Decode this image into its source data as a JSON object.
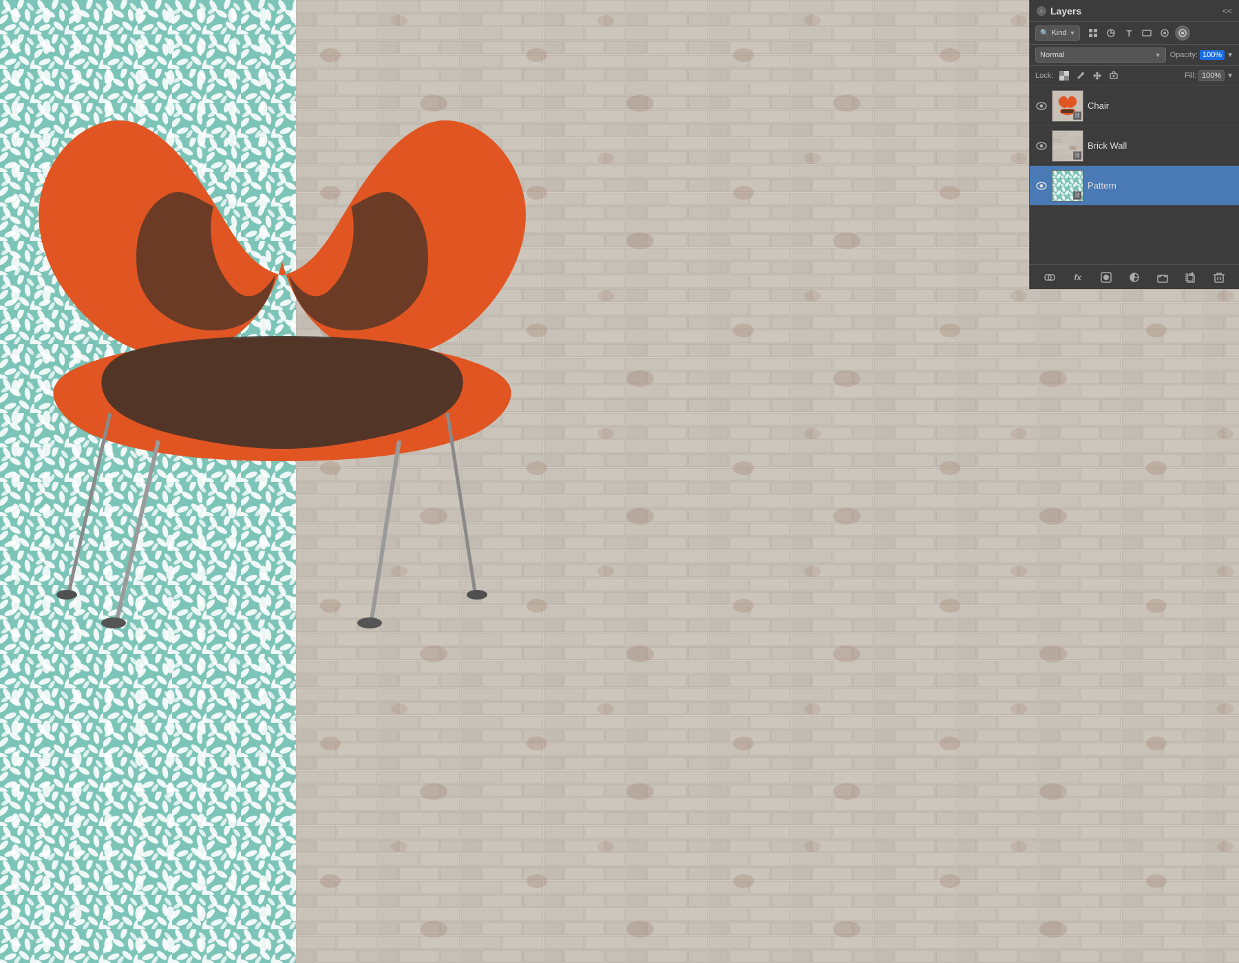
{
  "panel": {
    "title": "Layers",
    "close_label": "×",
    "expand_label": "<<"
  },
  "filter": {
    "kind_label": "Kind",
    "kind_placeholder": "Kind"
  },
  "blend": {
    "mode": "Normal",
    "opacity_label": "Opacity:",
    "opacity_value": "100%",
    "fill_label": "Fill:",
    "fill_value": "100%"
  },
  "lock": {
    "label": "Lock:"
  },
  "layers": [
    {
      "name": "Chair",
      "visible": true,
      "active": false,
      "thumb_type": "chair"
    },
    {
      "name": "Brick Wall",
      "visible": true,
      "active": false,
      "thumb_type": "brick"
    },
    {
      "name": "Pattern",
      "visible": true,
      "active": true,
      "thumb_type": "pattern"
    }
  ],
  "toolbar": {
    "link_icon": "🔗",
    "fx_label": "fx",
    "circle_icon": "○",
    "mask_icon": "◎",
    "folder_icon": "📁",
    "page_icon": "📄",
    "trash_icon": "🗑"
  },
  "colors": {
    "panel_bg": "#3c3c3c",
    "panel_active": "#4a7ab5",
    "teal": "#7dc4b8",
    "orange": "#e05a1a",
    "brick": "#d4ccc4"
  }
}
